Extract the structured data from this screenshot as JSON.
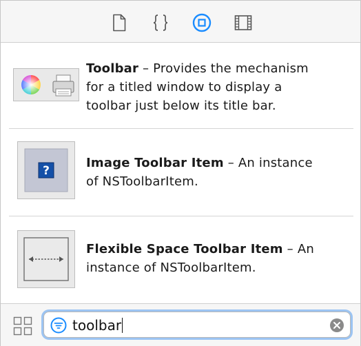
{
  "top_toolbar": {
    "buttons": [
      {
        "name": "file-inspector",
        "icon": "document-icon",
        "selected": false
      },
      {
        "name": "code-snippets",
        "icon": "braces-icon",
        "selected": false
      },
      {
        "name": "object-library",
        "icon": "circle-square-icon",
        "selected": true
      },
      {
        "name": "media-library",
        "icon": "film-strip-icon",
        "selected": false
      }
    ],
    "accent_color": "#1a8cff"
  },
  "library": {
    "items": [
      {
        "title": "Toolbar",
        "separator": " – ",
        "description_lines": [
          "Provides the mechanism",
          "for a titled window to display a",
          "toolbar just below its title bar."
        ],
        "icon": "color-wheel-and-printer-icon"
      },
      {
        "title": "Image Toolbar Item",
        "separator": " – ",
        "description_lines": [
          "An instance",
          "of NSToolbarItem."
        ],
        "icon": "question-mark-icon"
      },
      {
        "title": "Flexible Space Toolbar Item",
        "separator": " – ",
        "description_lines": [
          "An",
          "instance of NSToolbarItem."
        ],
        "icon": "flexible-space-icon"
      }
    ]
  },
  "filter_bar": {
    "search_value": "toolbar",
    "view_toggle_icon": "grid-icon",
    "filter_icon": "filter-icon",
    "clear_icon": "clear-icon"
  }
}
